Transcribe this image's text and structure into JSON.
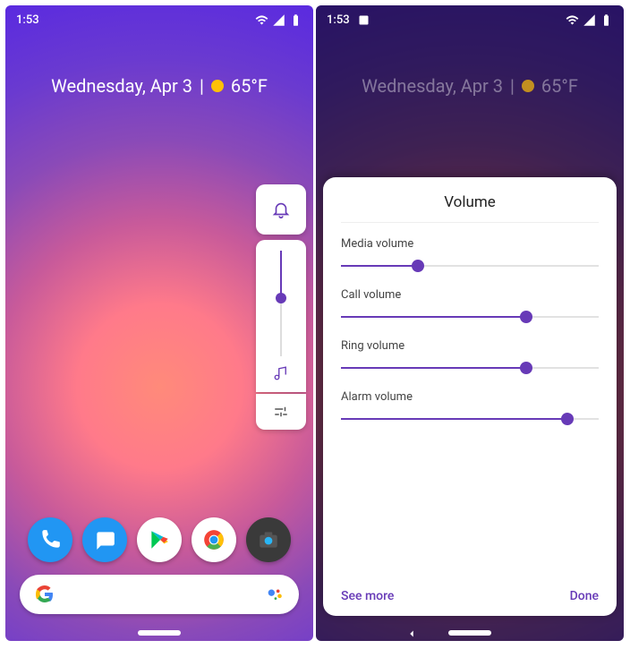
{
  "accent": "#673ab7",
  "status": {
    "time": "1:53"
  },
  "date": {
    "day": "Wednesday, Apr 3",
    "sep": "|",
    "temp": "65°F"
  },
  "mini_slider": {
    "percent": 45
  },
  "dock": [
    {
      "name": "phone",
      "bg": "#2196f3"
    },
    {
      "name": "messages",
      "bg": "#2196f3"
    },
    {
      "name": "play-store",
      "bg": "#fff"
    },
    {
      "name": "chrome",
      "bg": "#fff"
    },
    {
      "name": "camera",
      "bg": "#3a3a3a"
    }
  ],
  "panel": {
    "title": "Volume",
    "rows": [
      {
        "label": "Media volume",
        "percent": 30
      },
      {
        "label": "Call volume",
        "percent": 72
      },
      {
        "label": "Ring volume",
        "percent": 72
      },
      {
        "label": "Alarm volume",
        "percent": 88
      }
    ],
    "more": "See more",
    "done": "Done"
  }
}
